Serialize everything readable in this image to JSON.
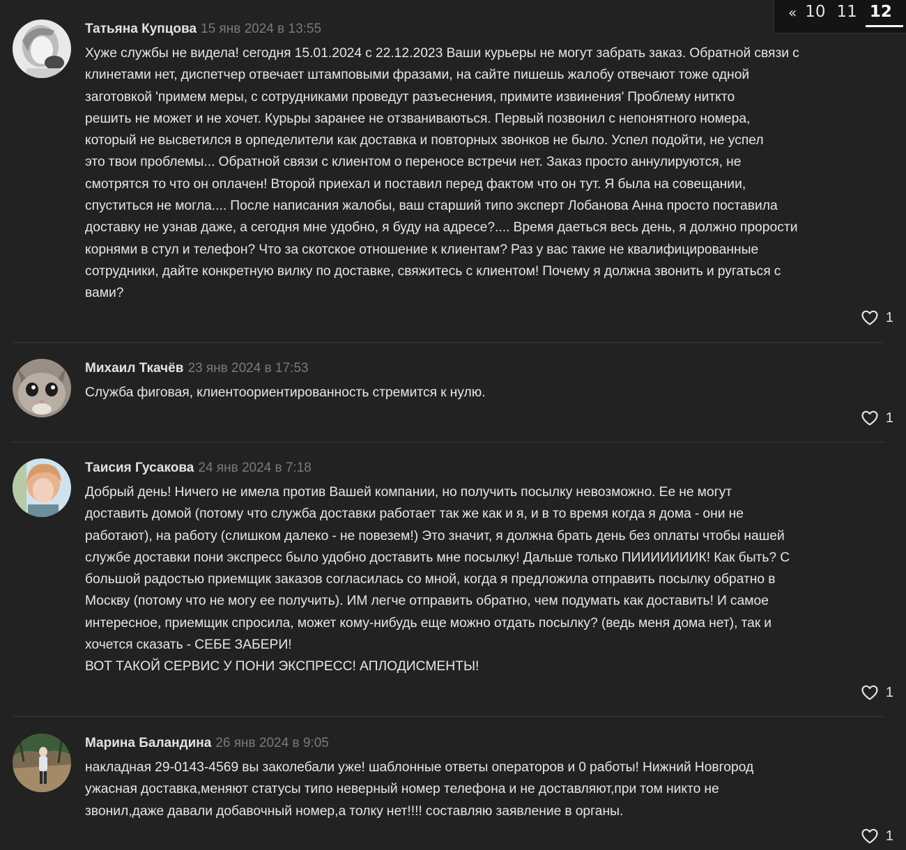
{
  "pagination": {
    "prev": "«",
    "pages": [
      "10",
      "11"
    ],
    "current": "12"
  },
  "comments": [
    {
      "author": "Татьяна Купцова",
      "date": "15 янв 2024 в 13:55",
      "text": "Хуже службы не видела! сегодня 15.01.2024 с 22.12.2023 Ваши курьеры не могут забрать заказ. Обратной связи с\nклинетами нет, диспетчер отвечает штамповыми фразами, на сайте пишешь жалобу отвечают тоже одной\nзаготовкой 'примем меры, с сотрудниками проведут разъеснения, примите извинения' Проблему ниткто\nрешить не может и не хочет. Курьры заранее не отзваниваються. Первый позвонил с непонятного номера,\nкоторый не высветился в орпеделители как доставка и повторных звонков не было. Успел подойти, не успел\nэто твои проблемы... Обратной связи с клиентом о переносе встречи нет. Заказ просто аннулируются, не\nсмотрятся то что он оплачен! Второй приехал и поставил перед фактом что он тут. Я была на совещании,\nспуститься не могла.... После написания жалобы, ваш старший типо эксперт Лобанова Анна просто поставила\nдоставку не узнав даже, а сегодня мне удобно, я буду на адресе?.... Время даеться весь день, я должно прорости\nкорнями в стул и телефон? Что за скотское отношение к клиентам? Раз у вас такие не квалифицированные\nсотрудники, дайте конкретную вилку по доставке, свяжитесь с клиентом! Почему я должна звонить и ругаться с\nвами?",
      "likes": "1"
    },
    {
      "author": "Михаил Ткачёв",
      "date": "23 янв 2024 в 17:53",
      "text": "Служба фиговая, клиентоориентированность стремится к нулю.",
      "likes": "1"
    },
    {
      "author": "Таисия Гусакова",
      "date": "24 янв 2024 в 7:18",
      "text": "Добрый день! Ничего не имела против Вашей компании, но получить посылку невозможно. Ее не могут\nдоставить домой (потому что служба доставки работает так же как и я, и в то время когда я дома - они не\nработают), на работу (слишком далеко - не повезем!) Это значит, я должна брать день без оплаты чтобы нашей\nслужбе доставки пони экспресс было удобно доставить мне посылку! Дальше только ПИИИИИИИК! Как быть? С\nбольшой радостью приемщик заказов согласилась со мной, когда я предложила отправить посылку обратно в\nМоскву (потому что не могу ее получить). ИМ легче отправить обратно, чем подумать как доставить! И самое\nинтересное, приемщик спросила, может кому-нибудь еще можно отдать посылку? (ведь меня дома нет), так и\nхочется сказать - СЕБЕ ЗАБЕРИ!\nВОТ ТАКОЙ СЕРВИС У ПОНИ ЭКСПРЕСС! АПЛОДИСМЕНТЫ!",
      "likes": "1"
    },
    {
      "author": "Марина Баландина",
      "date": "26 янв 2024 в 9:05",
      "text": "накладная 29-0143-4569 вы заколебали уже! шаблонные ответы операторов и 0 работы! Нижний Новгород\nужасная доставка,меняют статусы типо неверный номер телефона и не доставляют,при том никто не\nзвонил,даже давали добавочный номер,а толку нет!!!! составляю заявление в органы.",
      "likes": "1"
    }
  ]
}
